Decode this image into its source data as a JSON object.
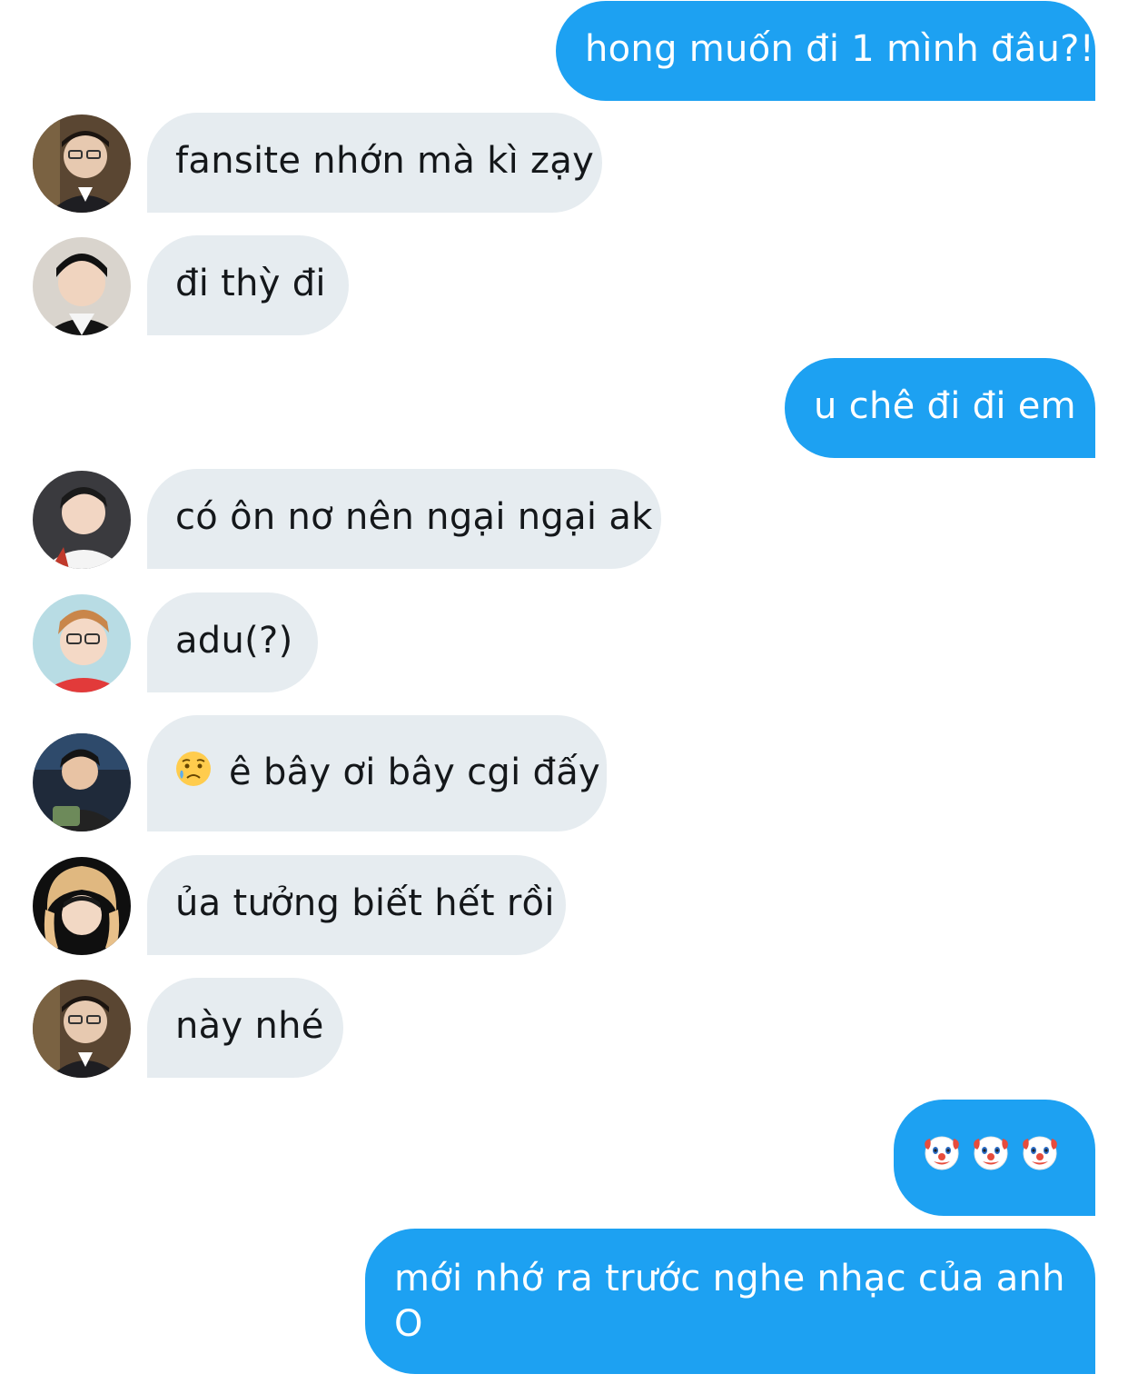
{
  "messages": [
    {
      "id": "m1",
      "side": "out",
      "text": "hong muốn đi 1 mình đâu?!"
    },
    {
      "id": "m2",
      "side": "in",
      "avatar": "avatar-a",
      "text": "fansite nhớn mà kì zạy"
    },
    {
      "id": "m3",
      "side": "in",
      "avatar": "avatar-b",
      "text": "đi thỳ đi"
    },
    {
      "id": "m4",
      "side": "out",
      "text": "u chê đi đi em"
    },
    {
      "id": "m5",
      "side": "in",
      "avatar": "avatar-c",
      "text": "có ôn nơ nên ngại ngại ak"
    },
    {
      "id": "m6",
      "side": "in",
      "avatar": "avatar-d",
      "text": "adu(?)"
    },
    {
      "id": "m7",
      "side": "in",
      "avatar": "avatar-e",
      "emoji": "sad-relieved-face-emoji",
      "text": "ê bây ơi bây cgi đấy"
    },
    {
      "id": "m8",
      "side": "in",
      "avatar": "avatar-f",
      "text": "ủa tưởng biết hết rồi"
    },
    {
      "id": "m9",
      "side": "in",
      "avatar": "avatar-a",
      "text": "này nhé"
    },
    {
      "id": "m10",
      "side": "out",
      "emoji": [
        "clown-face-emoji",
        "clown-face-emoji",
        "clown-face-emoji"
      ],
      "text": ""
    },
    {
      "id": "m11",
      "side": "out",
      "text": "mới nhớ ra trước nghe nhạc của anh O"
    }
  ],
  "colors": {
    "outgoing_bubble": "#1da1f2",
    "incoming_bubble": "#e6ecf0",
    "incoming_text": "#14171a",
    "outgoing_text": "#ffffff"
  }
}
